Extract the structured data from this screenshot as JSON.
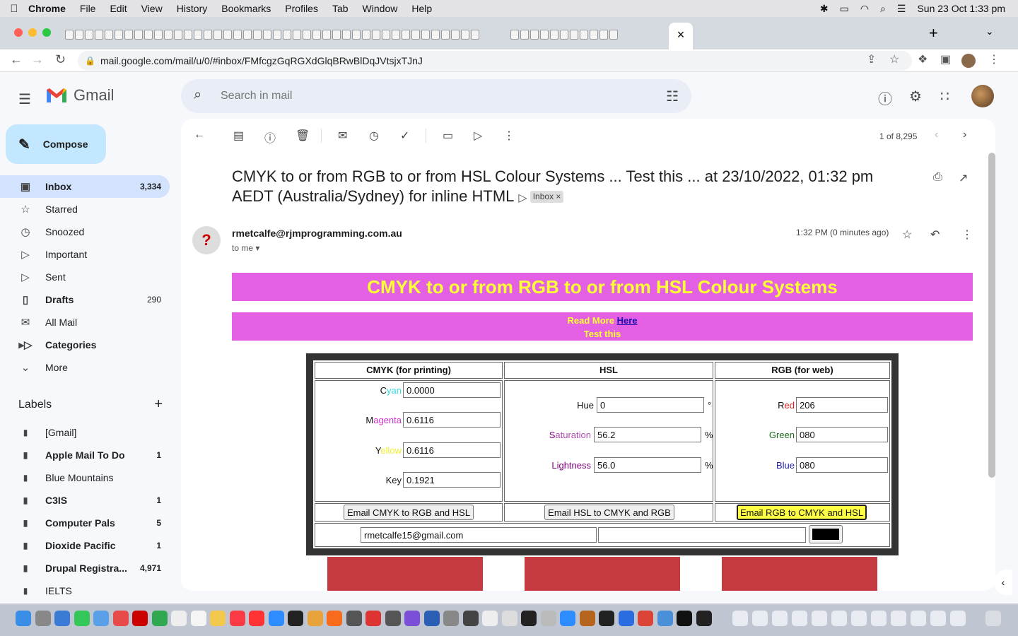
{
  "menubar": {
    "app": "Chrome",
    "items": [
      "File",
      "Edit",
      "View",
      "History",
      "Bookmarks",
      "Profiles",
      "Tab",
      "Window",
      "Help"
    ],
    "clock": "Sun 23 Oct  1:33 pm"
  },
  "browser": {
    "url": "mail.google.com/mail/u/0/#inbox/FMfcgzGqRGXdGlqBRwBlDqJVtsjxTJnJ"
  },
  "gmail": {
    "logo_text": "Gmail",
    "search_placeholder": "Search in mail",
    "compose_label": "Compose",
    "nav": [
      {
        "label": "Inbox",
        "count": "3,334"
      },
      {
        "label": "Starred",
        "count": ""
      },
      {
        "label": "Snoozed",
        "count": ""
      },
      {
        "label": "Important",
        "count": ""
      },
      {
        "label": "Sent",
        "count": ""
      },
      {
        "label": "Drafts",
        "count": "290"
      },
      {
        "label": "All Mail",
        "count": ""
      },
      {
        "label": "Categories",
        "count": ""
      },
      {
        "label": "More",
        "count": ""
      }
    ],
    "labels_heading": "Labels",
    "labels": [
      {
        "label": "[Gmail]",
        "count": ""
      },
      {
        "label": "Apple Mail To Do",
        "count": "1"
      },
      {
        "label": "Blue Mountains",
        "count": ""
      },
      {
        "label": "C3IS",
        "count": "1"
      },
      {
        "label": "Computer Pals",
        "count": "5"
      },
      {
        "label": "Dioxide Pacific",
        "count": "1"
      },
      {
        "label": "Drupal Registra...",
        "count": "4,971"
      },
      {
        "label": "IELTS",
        "count": ""
      }
    ],
    "pager": "1 of 8,295"
  },
  "email": {
    "subject": "CMYK to or from RGB to or from HSL Colour Systems ... Test this ... at 23/10/2022, 01:32 pm AEDT (Australia/Sydney) for inline HTML",
    "label_badge": "Inbox",
    "sender": "rmetcalfe@rjmprogramming.com.au",
    "to": "to me",
    "time": "1:32 PM (0 minutes ago)",
    "banner_title": "CMYK to or from RGB to or from HSL Colour Systems",
    "read_more": "Read More ",
    "read_more_link": "Here",
    "test_this": "Test this"
  },
  "converter": {
    "col_cmyk": "CMYK (for printing)",
    "col_hsl": "HSL",
    "col_rgb": "RGB (for web)",
    "cmyk": {
      "cyan_first": "C",
      "cyan_rest": "yan",
      "cyan": "0.0000",
      "magenta_first": "M",
      "magenta_rest": "agenta",
      "magenta": "0.6116",
      "yellow_first": "Y",
      "yellow_rest": "ellow",
      "yellow": "0.6116",
      "key_label": "Key",
      "key": "0.1921"
    },
    "hsl": {
      "hue_label": "Hue",
      "hue": "0",
      "hue_unit": "°",
      "sat_first": "S",
      "sat_rest": "aturation",
      "saturation": "56.2",
      "sat_unit": "%",
      "light_label": "Lightness",
      "lightness": "56.0",
      "light_unit": "%"
    },
    "rgb": {
      "red_first": "R",
      "red_rest": "ed",
      "red": "206",
      "green_label": "Green",
      "green": "080",
      "blue_label": "Blue",
      "blue": "080"
    },
    "btn_cmyk": "Email CMYK to RGB and HSL",
    "btn_hsl": "Email HSL to CMYK and RGB",
    "btn_rgb": "Email RGB to CMYK and HSL",
    "email_value": "rmetcalfe15@gmail.com",
    "swatch_color": "#000000",
    "box_color": "#c53a40"
  }
}
